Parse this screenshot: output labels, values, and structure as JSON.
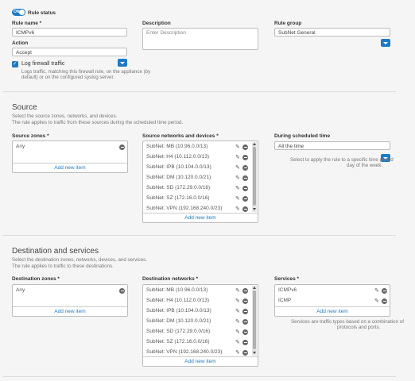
{
  "rule": {
    "status_label": "Rule status",
    "toggle_text": "ON",
    "name_label": "Rule name *",
    "name_value": "ICMPv6",
    "description_label": "Description",
    "description_placeholder": "Enter Description",
    "group_label": "Rule group",
    "group_value": "SubNet General",
    "action_label": "Action",
    "action_value": "Accept",
    "log_label": "Log firewall traffic",
    "log_checked": true,
    "log_help_line1": "Logs traffic, matching this firewall rule, on the appliance (by",
    "log_help_line2": "default) or on the configured syslog server."
  },
  "source": {
    "title": "Source",
    "desc_line1": "Select the source zones, networks, and devices.",
    "desc_line2": "The rule applies to traffic from these sources during the scheduled time period.",
    "zones_label": "Source zones *",
    "zones": [
      "Any"
    ],
    "zones_add": "Add new item",
    "networks_label": "Source networks and devices *",
    "networks": [
      "SubNet: MB (10.96.0.0/13)",
      "SubNet: H4 (10.112.0.0/13)",
      "SubNet: IPB (10.104.0.0/13)",
      "SubNet: DM (10.120.0.0/21)",
      "SubNet: SD (172.29.0.0/16)",
      "SubNet: SZ (172.16.0.0/16)",
      "SubNet: VPN (192.168.240.0/23)"
    ],
    "networks_add": "Add new item",
    "schedule_label": "During scheduled time",
    "schedule_value": "All the time",
    "schedule_help_line1": "Select to apply the rule to a specific time period",
    "schedule_help_line2": "day of the week."
  },
  "destination": {
    "title": "Destination and services",
    "desc_line1": "Select the destination zones, networks, devices, and services.",
    "desc_line2": "The rule applies to traffic to these destinations.",
    "zones_label": "Destination zones *",
    "zones": [
      "Any"
    ],
    "zones_add": "Add new item",
    "networks_label": "Destination networks *",
    "networks": [
      "SubNet: MB (10.96.0.0/13)",
      "SubNet: H4 (10.112.0.0/13)",
      "SubNet: IPB (10.104.0.0/13)",
      "SubNet: DM (10.120.0.0/21)",
      "SubNet: SD (172.29.0.0/16)",
      "SubNet: SZ (172.16.0.0/16)",
      "SubNet: VPN (192.168.240.0/23)"
    ],
    "networks_add": "Add new item",
    "services_label": "Services *",
    "services": [
      "ICMPv6",
      "ICMP"
    ],
    "services_add": "Add new item",
    "services_help_line1": "Services are traffic types based on a combination of",
    "services_help_line2": "protocols and ports."
  },
  "colors": {
    "accent": "#1e7ac4",
    "toggle_on": "#1e7ac4",
    "background": "#f5f5f5"
  },
  "icons": {
    "remove": "minus-circle-icon",
    "edit": "pencil-icon",
    "dropdown": "chevron-down-icon"
  }
}
